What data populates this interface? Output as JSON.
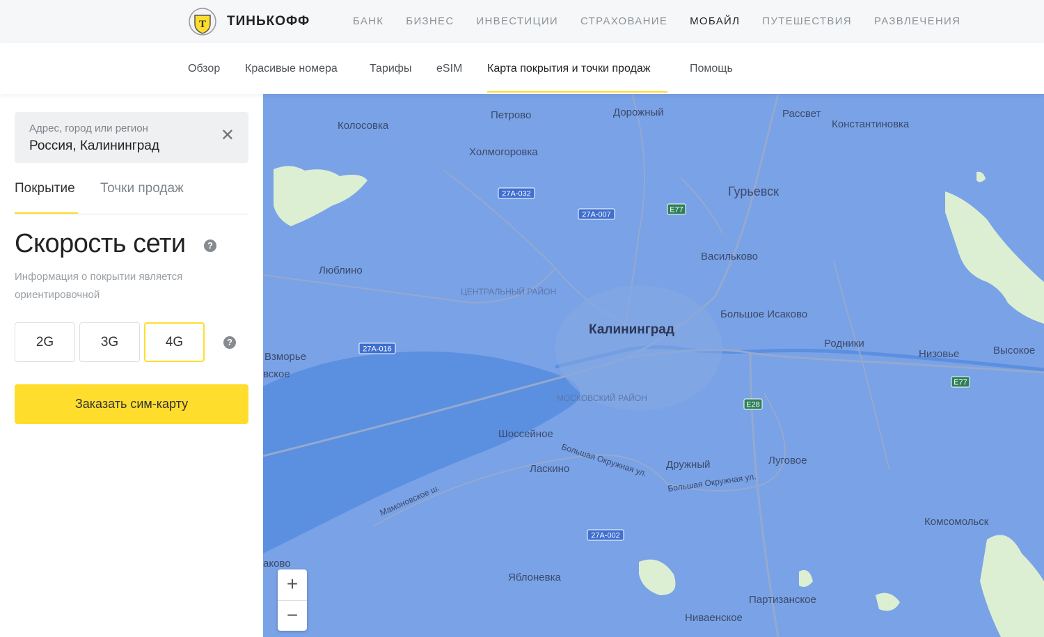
{
  "brand": {
    "name": "ТИНЬКОФФ"
  },
  "topnav": [
    "БАНК",
    "БИЗНЕС",
    "ИНВЕСТИЦИИ",
    "СТРАХОВАНИЕ",
    "МОБАЙЛ",
    "ПУТЕШЕСТВИЯ",
    "РАЗВЛЕЧЕНИЯ"
  ],
  "topnav_active": "МОБАЙЛ",
  "subnav": [
    "Обзор",
    "Красивые номера",
    "Тарифы",
    "eSIM",
    "Карта покрытия и точки продаж",
    "Помощь"
  ],
  "subnav_active": "Карта покрытия и точки продаж",
  "search": {
    "label": "Адрес, город или регион",
    "value": "Россия, Калининград"
  },
  "tabs": {
    "coverage": "Покрытие",
    "points": "Точки продаж",
    "active": "Покрытие"
  },
  "speed": {
    "title": "Скорость сети",
    "note": "Информация о покрытии является ориентировочной",
    "generations": [
      "2G",
      "3G",
      "4G"
    ],
    "selected": "4G"
  },
  "order_button": "Заказать сим-карту",
  "map": {
    "city": "Калининград",
    "places": [
      "Петрово",
      "Дорожный",
      "Рассвет",
      "Колосовка",
      "Константиновка",
      "Холмогоровка",
      "Гурьевск",
      "Васильково",
      "Люблино",
      "Большое Исаково",
      "Родники",
      "Низовье",
      "Высокое",
      "Взморье",
      "вское",
      "Шоссейное",
      "Ласкино",
      "Дружный",
      "Луговое",
      "Комсомольск",
      "Яблоневка",
      "Партизанское",
      "Ниваенское",
      "аково"
    ],
    "districts": [
      "ЦЕНТРАЛЬНЫЙ РАЙОН",
      "МОСКОВСКИЙ РАЙОН"
    ],
    "roads": [
      "27А-032",
      "27А-007",
      "E77",
      "27А-016",
      "E28",
      "E77",
      "27А-002"
    ],
    "streets": [
      "Большая Окружная ул.",
      "Большая Окружная ул.",
      "Мамоновское ш."
    ],
    "zoom_in": "+",
    "zoom_out": "−",
    "colors": {
      "coverage_4g": "#7aa2e6",
      "water": "#5b8fe0",
      "no_coverage": "#dcefd2"
    }
  }
}
